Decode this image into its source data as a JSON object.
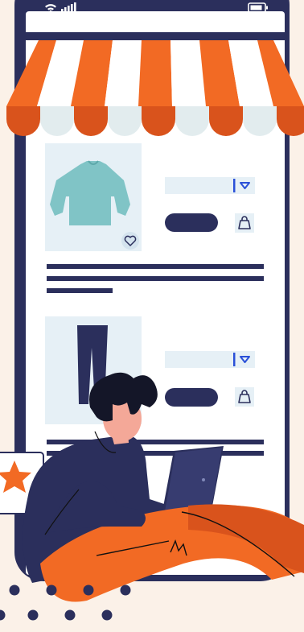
{
  "colors": {
    "background": "#fbf1e8",
    "phone_frame": "#2b2f5c",
    "screen": "#ffffff",
    "awning_orange": "#f26a24",
    "awning_orange_dark": "#d9531c",
    "awning_white": "#ffffff",
    "awning_scallop_white": "#e2ecee",
    "product_bg": "#e6f0f6",
    "shirt": "#80c4c6",
    "navy": "#2b2f5c",
    "blue_caret": "#2a50d8"
  },
  "status_bar": {
    "icons": [
      "wifi-icon",
      "signal-icon",
      "battery-icon"
    ]
  },
  "products": [
    {
      "image": "shirt",
      "has_favorite": true,
      "text_lines": 3
    },
    {
      "image": "pants",
      "has_favorite": false,
      "text_lines": 2
    }
  ],
  "decor": [
    "star-card",
    "dots",
    "person-with-laptop"
  ]
}
